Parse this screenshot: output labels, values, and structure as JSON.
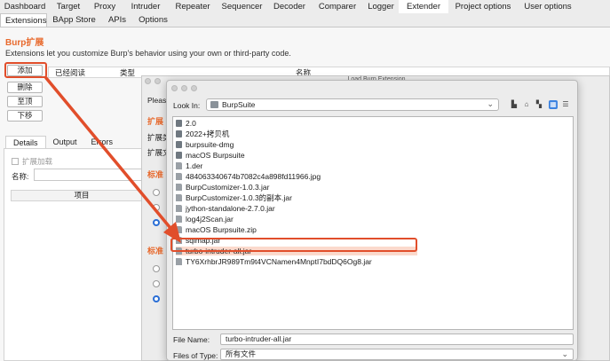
{
  "main_tabs": [
    {
      "label": "Dashboard"
    },
    {
      "label": "Target"
    },
    {
      "label": "Proxy"
    },
    {
      "label": "Intruder"
    },
    {
      "label": "Repeater"
    },
    {
      "label": "Sequencer"
    },
    {
      "label": "Decoder"
    },
    {
      "label": "Comparer"
    },
    {
      "label": "Logger"
    },
    {
      "label": "Extender"
    },
    {
      "label": "Project options"
    },
    {
      "label": "User options"
    }
  ],
  "active_main_tab": "Extender",
  "sub_tabs": [
    {
      "label": "Extensions"
    },
    {
      "label": "BApp Store"
    },
    {
      "label": "APIs"
    },
    {
      "label": "Options"
    }
  ],
  "active_sub_tab": "Extensions",
  "section": {
    "title": "Burp扩展",
    "description": "Extensions let you customize Burp's behavior using your own or third-party code."
  },
  "side_buttons": {
    "add": "添加",
    "remove": "删除",
    "top": "至顶",
    "down": "下移"
  },
  "extensions_table": {
    "col_loaded": "已经阅读",
    "col_type": "类型",
    "col_name": "名称"
  },
  "lower_tabs": [
    {
      "label": "Details"
    },
    {
      "label": "Output"
    },
    {
      "label": "Errors"
    }
  ],
  "details": {
    "extension_loaded_label": "扩展加载",
    "name_label": "名称:",
    "items_header": "项目"
  },
  "back_dialog": {
    "title": "Load Burp Extension",
    "please_text": "Pleas",
    "ext_details_heading": "扩展",
    "ext_type_label": "扩展类",
    "ext_file_label": "扩展文",
    "std_output_heading": "标准",
    "std_error_heading": "标准"
  },
  "file_dialog": {
    "look_in_label": "Look In:",
    "look_in_value": "BurpSuite",
    "files": [
      {
        "name": "2.0",
        "kind": "folder"
      },
      {
        "name": "2022+拷贝机",
        "kind": "folder"
      },
      {
        "name": "burpsuite-dmg",
        "kind": "folder"
      },
      {
        "name": "macOS Burpsuite",
        "kind": "folder"
      },
      {
        "name": "1.der",
        "kind": "file"
      },
      {
        "name": "484063340674b7082c4a898fd11966.jpg",
        "kind": "file"
      },
      {
        "name": "BurpCustomizer-1.0.3.jar",
        "kind": "file"
      },
      {
        "name": "BurpCustomizer-1.0.3的副本.jar",
        "kind": "file"
      },
      {
        "name": "jython-standalone-2.7.0.jar",
        "kind": "file"
      },
      {
        "name": "log4j2Scan.jar",
        "kind": "file"
      },
      {
        "name": "macOS Burpsuite.zip",
        "kind": "file"
      },
      {
        "name": "sqlmap.jar",
        "kind": "file"
      },
      {
        "name": "turbo-intruder-all.jar",
        "kind": "file",
        "selected": true
      },
      {
        "name": "TY6XrhbrJR989Tm9t4VCNamen4MnptI7bdDQ6Og8.jar",
        "kind": "file"
      }
    ],
    "file_name_label": "File Name:",
    "file_name_value": "turbo-intruder-all.jar",
    "files_of_type_label": "Files of Type:",
    "files_of_type_value": "所有文件"
  },
  "colors": {
    "accent": "#e8692c",
    "annotation": "#e14e2b",
    "selected_row": "#fbd9cc"
  }
}
